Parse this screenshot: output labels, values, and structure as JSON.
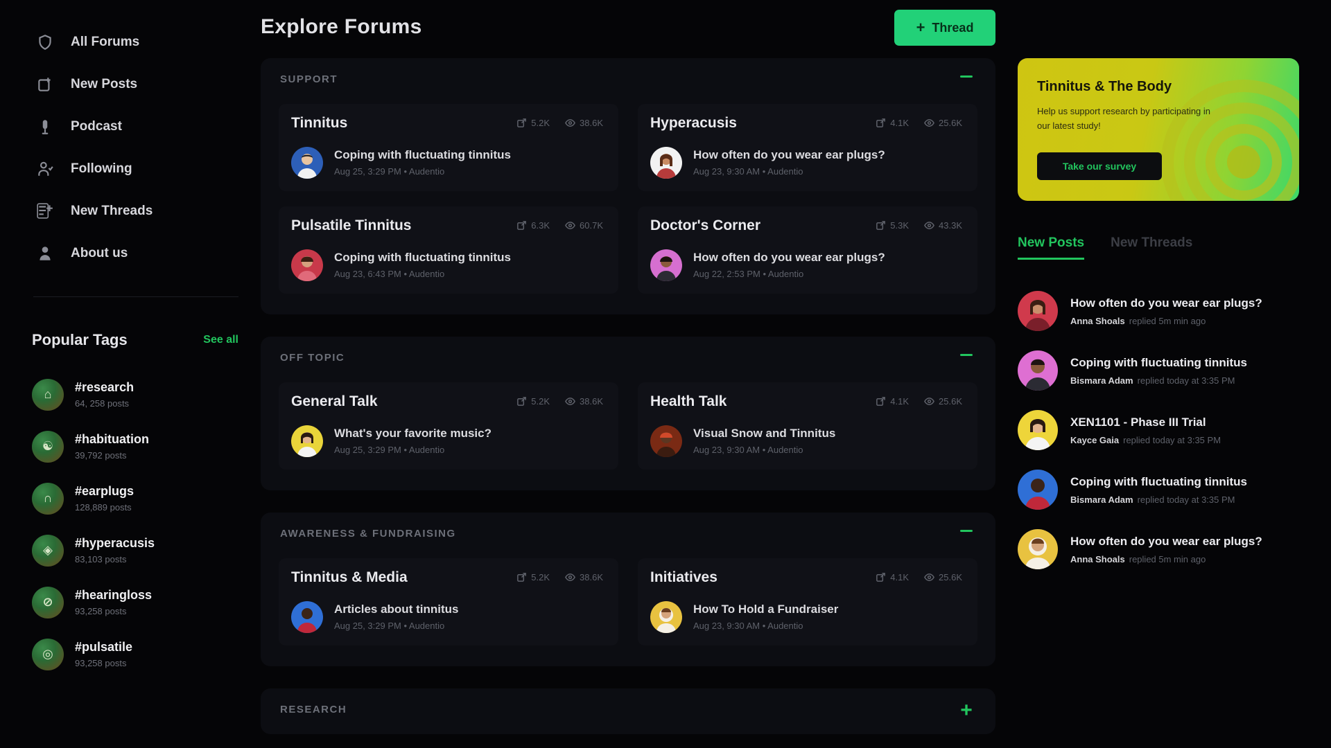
{
  "sidebar": {
    "nav": [
      {
        "label": "All Forums",
        "icon": "shield-icon"
      },
      {
        "label": "New Posts",
        "icon": "new-post-icon"
      },
      {
        "label": "Podcast",
        "icon": "microphone-icon"
      },
      {
        "label": "Following",
        "icon": "users-icon"
      },
      {
        "label": "New Threads",
        "icon": "new-thread-icon"
      },
      {
        "label": "About us",
        "icon": "person-icon"
      }
    ],
    "tags_title": "Popular Tags",
    "see_all": "See all",
    "tags": [
      {
        "name": "#research",
        "count": "64, 258 posts",
        "icon": "research-icon"
      },
      {
        "name": "#habituation",
        "count": "39,792 posts",
        "icon": "habituation-icon"
      },
      {
        "name": "#earplugs",
        "count": "128,889 posts",
        "icon": "earplugs-icon"
      },
      {
        "name": "#hyperacusis",
        "count": "83,103 posts",
        "icon": "hyperacusis-icon"
      },
      {
        "name": "#hearingloss",
        "count": "93,258 posts",
        "icon": "hearing-loss-icon"
      },
      {
        "name": "#pulsatile",
        "count": "93,258 posts",
        "icon": "pulsatile-icon"
      }
    ]
  },
  "main": {
    "title": "Explore Forums",
    "thread_button": "Thread",
    "sections": [
      {
        "name": "SUPPORT",
        "collapsed": false,
        "cards": [
          {
            "title": "Tinnitus",
            "posts": "5.2K",
            "views": "38.6K",
            "post": "Coping with fluctuating tinnitus",
            "meta": "Aug 25, 3:29 PM  •  Audentio"
          },
          {
            "title": "Hyperacusis",
            "posts": "4.1K",
            "views": "25.6K",
            "post": "How often do you wear ear plugs?",
            "meta": "Aug 23, 9:30 AM  •  Audentio"
          },
          {
            "title": "Pulsatile Tinnitus",
            "posts": "6.3K",
            "views": "60.7K",
            "post": "Coping with fluctuating tinnitus",
            "meta": "Aug 23, 6:43 PM  •  Audentio"
          },
          {
            "title": "Doctor's Corner",
            "posts": "5.3K",
            "views": "43.3K",
            "post": "How often do you wear ear plugs?",
            "meta": "Aug 22, 2:53 PM  •  Audentio"
          }
        ]
      },
      {
        "name": "OFF TOPIC",
        "collapsed": false,
        "cards": [
          {
            "title": "General Talk",
            "posts": "5.2K",
            "views": "38.6K",
            "post": "What's your favorite music?",
            "meta": "Aug 25, 3:29 PM  •  Audentio"
          },
          {
            "title": "Health Talk",
            "posts": "4.1K",
            "views": "25.6K",
            "post": "Visual Snow and Tinnitus",
            "meta": "Aug 23, 9:30 AM  •  Audentio"
          }
        ]
      },
      {
        "name": "AWARENESS & FUNDRAISING",
        "collapsed": false,
        "cards": [
          {
            "title": "Tinnitus & Media",
            "posts": "5.2K",
            "views": "38.6K",
            "post": "Articles about tinnitus",
            "meta": "Aug 25, 3:29 PM  •  Audentio"
          },
          {
            "title": "Initiatives",
            "posts": "4.1K",
            "views": "25.6K",
            "post": "How To Hold a Fundraiser",
            "meta": "Aug 23, 9:30 AM  •  Audentio"
          }
        ]
      },
      {
        "name": "RESEARCH",
        "collapsed": true,
        "cards": []
      }
    ]
  },
  "right": {
    "promo": {
      "title": "Tinnitus & The Body",
      "text": "Help us support research by participating in our latest study!",
      "button": "Take our survey"
    },
    "tabs": [
      {
        "label": "New Posts",
        "active": true
      },
      {
        "label": "New Threads",
        "active": false
      }
    ],
    "recent": [
      {
        "title": "How often do you wear ear plugs?",
        "author": "Anna Shoals",
        "time": "replied 5m min ago"
      },
      {
        "title": "Coping with fluctuating tinnitus",
        "author": "Bismara Adam",
        "time": "replied today at 3:35 PM"
      },
      {
        "title": "XEN1101 - Phase III Trial",
        "author": "Kayce Gaia",
        "time": "replied today at 3:35 PM"
      },
      {
        "title": "Coping with fluctuating tinnitus",
        "author": "Bismara Adam",
        "time": "replied today at 3:35 PM"
      },
      {
        "title": "How often do you wear ear plugs?",
        "author": "Anna Shoals",
        "time": "replied 5m min ago"
      }
    ]
  },
  "colors": {
    "accent": "#22c55e",
    "background": "#050507",
    "panel": "#0c0d12",
    "card": "#101117"
  }
}
